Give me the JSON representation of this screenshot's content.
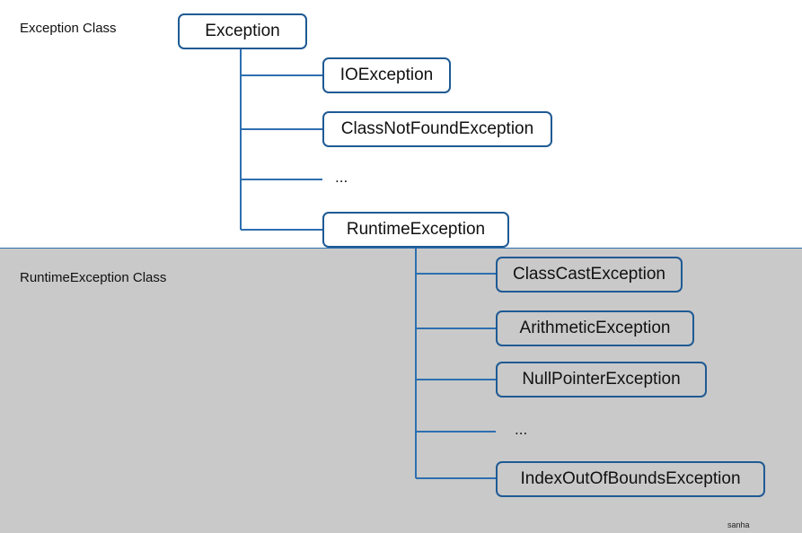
{
  "top_section": {
    "label": "Exception Class",
    "root": "Exception",
    "children": [
      "IOException",
      "ClassNotFoundException",
      "...",
      "RuntimeException"
    ]
  },
  "bottom_section": {
    "label": "RuntimeException Class",
    "children": [
      "ClassCastException",
      "ArithmeticException",
      "NullPointerException",
      "...",
      "IndexOutOfBoundsException"
    ]
  },
  "signature": "sanha",
  "colors": {
    "box_border": "#1f5a94",
    "connector": "#2e6fb0",
    "bottom_background": "#c9c9c9"
  }
}
